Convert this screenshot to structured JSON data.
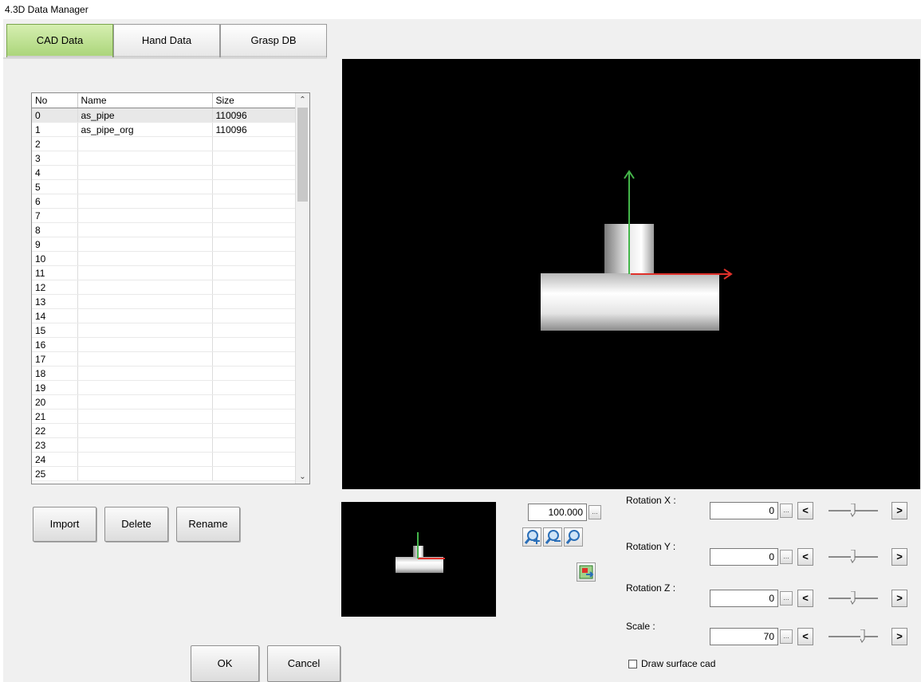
{
  "window": {
    "title": "4.3D Data Manager"
  },
  "tabs": [
    {
      "label": "CAD Data",
      "active": true
    },
    {
      "label": "Hand Data",
      "active": false
    },
    {
      "label": "Grasp DB",
      "active": false
    }
  ],
  "cad_list": {
    "columns": [
      "No",
      "Name",
      "Size"
    ],
    "rows": [
      {
        "no": "0",
        "name": "as_pipe",
        "size": "110096"
      },
      {
        "no": "1",
        "name": "as_pipe_org",
        "size": "110096"
      },
      {
        "no": "2",
        "name": "",
        "size": ""
      },
      {
        "no": "3",
        "name": "",
        "size": ""
      },
      {
        "no": "4",
        "name": "",
        "size": ""
      },
      {
        "no": "5",
        "name": "",
        "size": ""
      },
      {
        "no": "6",
        "name": "",
        "size": ""
      },
      {
        "no": "7",
        "name": "",
        "size": ""
      },
      {
        "no": "8",
        "name": "",
        "size": ""
      },
      {
        "no": "9",
        "name": "",
        "size": ""
      },
      {
        "no": "10",
        "name": "",
        "size": ""
      },
      {
        "no": "11",
        "name": "",
        "size": ""
      },
      {
        "no": "12",
        "name": "",
        "size": ""
      },
      {
        "no": "13",
        "name": "",
        "size": ""
      },
      {
        "no": "14",
        "name": "",
        "size": ""
      },
      {
        "no": "15",
        "name": "",
        "size": ""
      },
      {
        "no": "16",
        "name": "",
        "size": ""
      },
      {
        "no": "17",
        "name": "",
        "size": ""
      },
      {
        "no": "18",
        "name": "",
        "size": ""
      },
      {
        "no": "19",
        "name": "",
        "size": ""
      },
      {
        "no": "20",
        "name": "",
        "size": ""
      },
      {
        "no": "21",
        "name": "",
        "size": ""
      },
      {
        "no": "22",
        "name": "",
        "size": ""
      },
      {
        "no": "23",
        "name": "",
        "size": ""
      },
      {
        "no": "24",
        "name": "",
        "size": ""
      },
      {
        "no": "25",
        "name": "",
        "size": ""
      }
    ],
    "selected_index": 0
  },
  "buttons": {
    "import": "Import",
    "delete": "Delete",
    "rename": "Rename",
    "ok": "OK",
    "cancel": "Cancel"
  },
  "zoom": {
    "value": "100.000"
  },
  "icons": {
    "zoom_in": "zoom-in-icon",
    "zoom_out": "zoom-out-icon",
    "zoom_reset": "zoom-fit-icon",
    "fit_view": "fit-view-icon"
  },
  "controls": [
    {
      "label": "Rotation X :",
      "value": "0",
      "slider_fraction": 0.5
    },
    {
      "label": "Rotation Y :",
      "value": "0",
      "slider_fraction": 0.5
    },
    {
      "label": "Rotation Z :",
      "value": "0",
      "slider_fraction": 0.5
    },
    {
      "label": "Scale :",
      "value": "70",
      "slider_fraction": 0.7
    }
  ],
  "draw_surface": {
    "label": "Draw surface cad",
    "checked": false
  },
  "colors": {
    "tab_active": "#a9d478",
    "axis_x": "#e0312b",
    "axis_y": "#44b54a",
    "viewport_bg": "#000000"
  }
}
